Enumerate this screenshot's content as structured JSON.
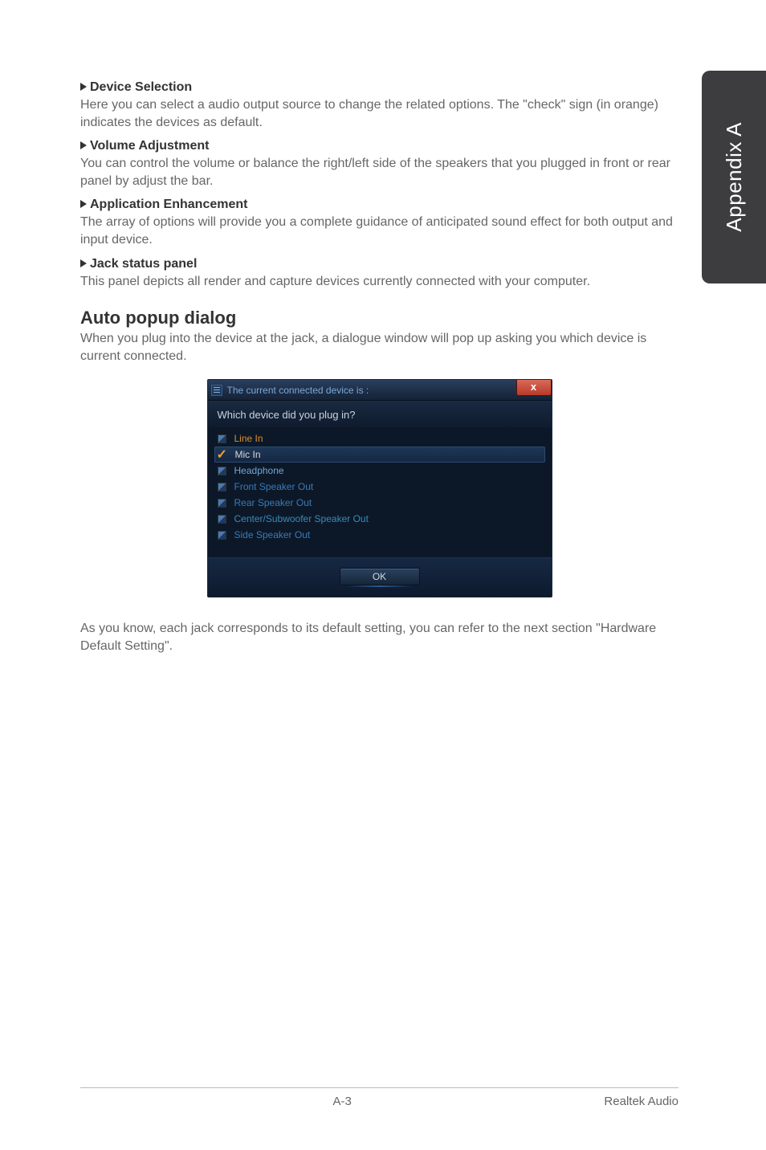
{
  "sideTab": "Appendix A",
  "sections": [
    {
      "title": "Device Selection",
      "body": "Here you can select a audio output source to change the related options. The \"check\" sign (in orange) indicates the devices as default."
    },
    {
      "title": "Volume Adjustment",
      "body": "You can control the volume or balance the right/left side of the speakers that you plugged in front or rear panel by adjust the bar."
    },
    {
      "title": "Application Enhancement",
      "body": "The array of options will provide you a complete guidance of anticipated sound effect for both output and input device."
    },
    {
      "title": "Jack status panel",
      "body": "This panel depicts all render and capture devices currently connected with your computer."
    }
  ],
  "autoPopup": {
    "heading": "Auto popup dialog",
    "intro": "When you plug into the device at the jack, a dialogue window will pop up asking you which device is current connected."
  },
  "dialog": {
    "title": "The current connected device is :",
    "close": "x",
    "question": "Which device did you plug in?",
    "items": [
      {
        "label": "Line In",
        "cls": "c-linein",
        "icon": "box",
        "sel": false
      },
      {
        "label": "Mic In",
        "cls": "c-micin",
        "icon": "check",
        "sel": true
      },
      {
        "label": "Headphone",
        "cls": "c-head",
        "icon": "box",
        "sel": false
      },
      {
        "label": "Front Speaker Out",
        "cls": "c-front",
        "icon": "box",
        "sel": false
      },
      {
        "label": "Rear Speaker Out",
        "cls": "c-rear",
        "icon": "box",
        "sel": false
      },
      {
        "label": "Center/Subwoofer Speaker Out",
        "cls": "c-center",
        "icon": "box",
        "sel": false
      },
      {
        "label": "Side Speaker Out",
        "cls": "c-side",
        "icon": "box",
        "sel": false
      }
    ],
    "ok": "OK"
  },
  "afterDialog": "As you know, each jack corresponds to its default setting, you can refer to the next section \"Hardware Default Setting\".",
  "footer": {
    "page": "A-3",
    "right": "Realtek Audio"
  }
}
